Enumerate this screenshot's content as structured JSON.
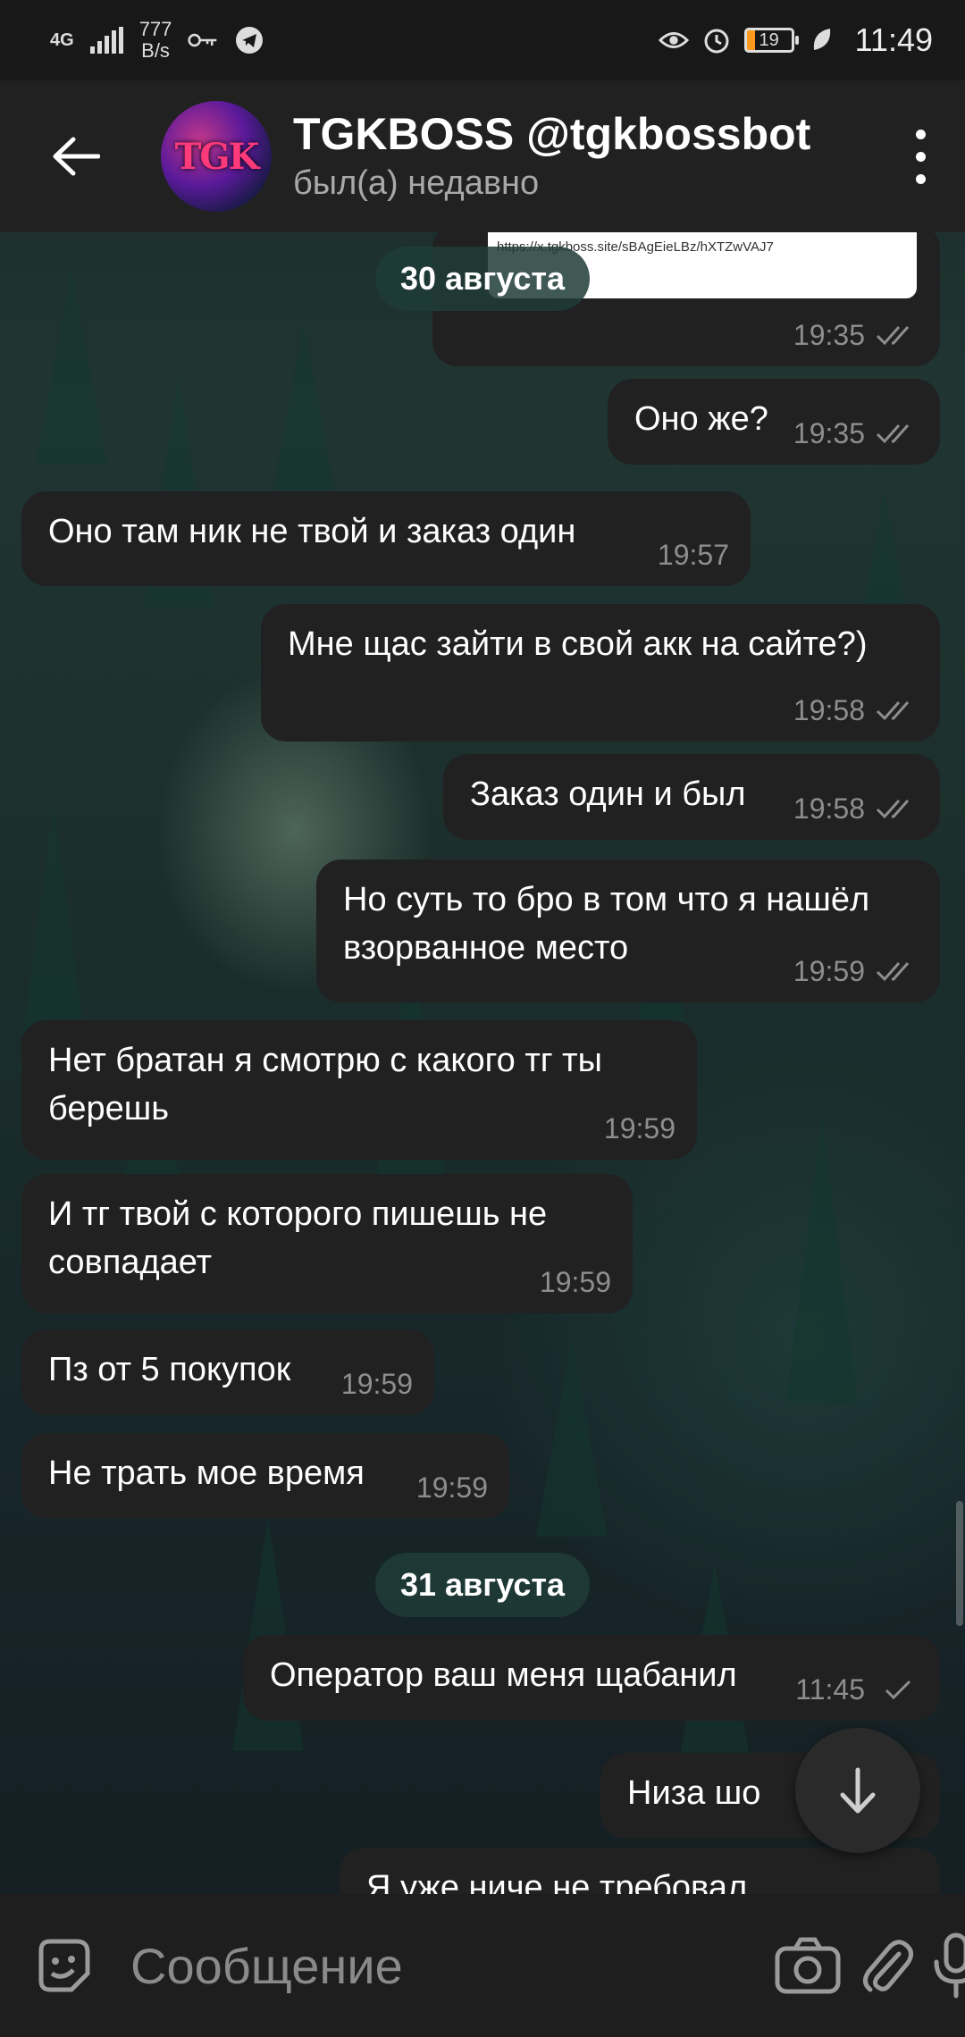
{
  "status_bar": {
    "network": "4G",
    "speed_value": "777",
    "speed_unit": "B/s",
    "battery": "19",
    "time": "11:49"
  },
  "header": {
    "title": "TGKBOSS @tgkbossbot",
    "subtitle": "был(а) недавно",
    "avatar_text": "TGK"
  },
  "link_preview": {
    "url": "https://x.tgkboss.site/sBAgEieLBz/hXTZwVAJ7"
  },
  "dates": [
    "30 августа",
    "31 августа"
  ],
  "messages": [
    {
      "dir": "out",
      "text": "",
      "time": "19:35",
      "status": "read"
    },
    {
      "dir": "out",
      "text": "Оно же?",
      "time": "19:35",
      "status": "read"
    },
    {
      "dir": "in",
      "text": "Оно там ник не твой и заказ один",
      "time": "19:57"
    },
    {
      "dir": "out",
      "text": "Мне щас зайти в свой акк на сайте?)",
      "time": "19:58",
      "status": "read"
    },
    {
      "dir": "out",
      "text": "Заказ один и был",
      "time": "19:58",
      "status": "read"
    },
    {
      "dir": "out",
      "text": "Но суть то бро в том что я нашёл взорванное место",
      "time": "19:59",
      "status": "read"
    },
    {
      "dir": "in",
      "text": "Нет братан я смотрю с какого тг ты берешь",
      "time": "19:59"
    },
    {
      "dir": "in",
      "text": "И тг твой с которого пишешь не совпадает",
      "time": "19:59"
    },
    {
      "dir": "in",
      "text": "Пз от 5 покупок",
      "time": "19:59"
    },
    {
      "dir": "in",
      "text": "Не трать мое время",
      "time": "19:59"
    },
    {
      "dir": "out",
      "text": "Оператор ваш меня щабанил",
      "time": "11:45",
      "status": "sent"
    },
    {
      "dir": "out",
      "text": "Низа шо",
      "time": "",
      "status": ""
    },
    {
      "dir": "out",
      "text": "Я уже ниче не требовал",
      "time": "",
      "status": ""
    }
  ],
  "composer": {
    "placeholder": "Сообщение"
  },
  "colors": {
    "bubble": "#212121",
    "header": "#212121",
    "time": "#8e8e8e",
    "date_pill": "#1e3c37"
  }
}
